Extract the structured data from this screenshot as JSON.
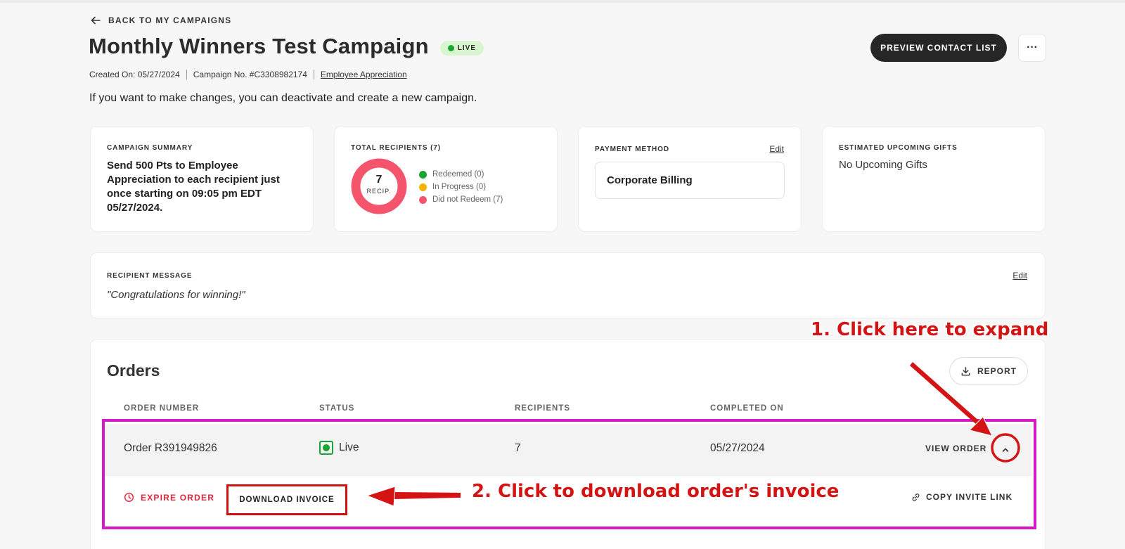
{
  "header": {
    "back_label": "BACK TO MY CAMPAIGNS",
    "title": "Monthly Winners Test Campaign",
    "status_badge": "LIVE",
    "created_on": "Created On: 05/27/2024",
    "campaign_no": "Campaign No. #C3308982174",
    "category_link": "Employee Appreciation",
    "info_text": "If you want to make changes, you can deactivate and create a new campaign.",
    "preview_button": "PREVIEW CONTACT LIST",
    "more_button": "···"
  },
  "summary_card": {
    "label": "CAMPAIGN SUMMARY",
    "text": "Send 500 Pts to Employee Appreciation to each recipient just once starting on 09:05 pm EDT 05/27/2024."
  },
  "recipients_card": {
    "label": "TOTAL RECIPIENTS (7)",
    "total": "7",
    "total_sub": "RECIP.",
    "legend": [
      {
        "label": "Redeemed (0)",
        "color": "#19a531"
      },
      {
        "label": "In Progress (0)",
        "color": "#f5b301"
      },
      {
        "label": "Did not Redeem (7)",
        "color": "#f4546c"
      }
    ],
    "ring_color": "#f4546c"
  },
  "payment_card": {
    "label": "PAYMENT METHOD",
    "edit": "Edit",
    "method": "Corporate Billing"
  },
  "gifts_card": {
    "label": "ESTIMATED UPCOMING GIFTS",
    "value": "No Upcoming Gifts"
  },
  "message_card": {
    "label": "RECIPIENT MESSAGE",
    "edit": "Edit",
    "message": "\"Congratulations for winning!\""
  },
  "orders": {
    "title": "Orders",
    "report_button": "REPORT",
    "columns": [
      "ORDER NUMBER",
      "STATUS",
      "RECIPIENTS",
      "COMPLETED ON"
    ],
    "row": {
      "order_number": "Order R391949826",
      "status": "Live",
      "recipients": "7",
      "completed_on": "05/27/2024",
      "view_order": "VIEW ORDER"
    },
    "actions": {
      "expire": "EXPIRE ORDER",
      "download_invoice": "DOWNLOAD INVOICE",
      "copy_invite": "COPY INVITE LINK"
    }
  },
  "annotations": {
    "step1": "1. Click here to expand",
    "step2": "2. Click to download order's invoice",
    "annotation_color": "#d41414",
    "highlight_color": "#d61ac5"
  }
}
